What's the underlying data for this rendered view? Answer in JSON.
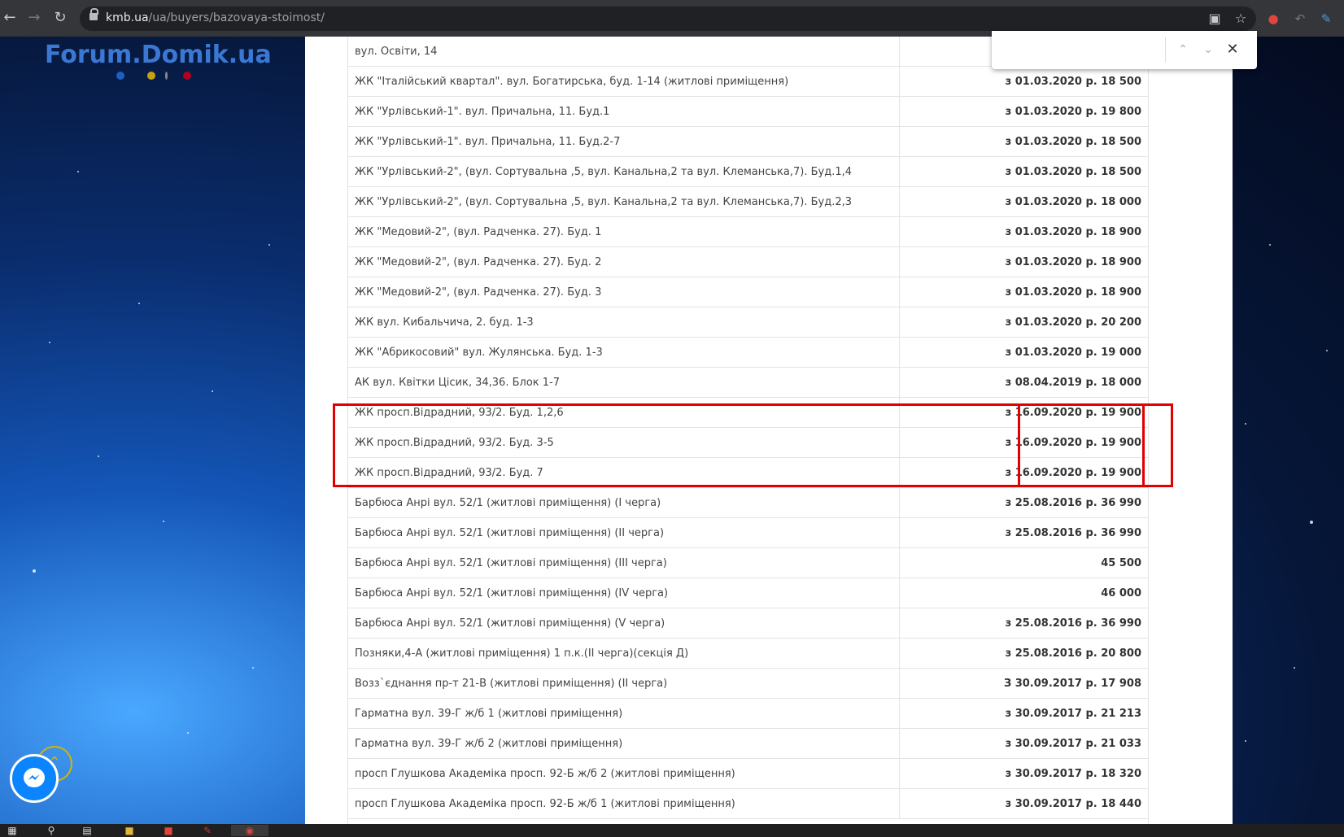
{
  "browser": {
    "url_host": "kmb.ua",
    "url_path": "/ua/buyers/bazovaya-stoimost/"
  },
  "site": {
    "logo_text": "Forum.Domik.ua",
    "logo_dot_colors": [
      "#1f5fbf",
      "#c8a010",
      "#8a8a8a",
      "#b00020"
    ]
  },
  "find_bar": {
    "value": ""
  },
  "table": {
    "rows": [
      {
        "address": "вул. Освіти, 14",
        "price": ""
      },
      {
        "address": " ЖК \"Італійський квартал\". вул. Богатирська, буд. 1-14 (житлові приміщення)",
        "price": "з 01.03.2020 р. 18 500"
      },
      {
        "address": "ЖК \"Урлівський-1\". вул. Причальна, 11. Буд.1",
        "price": "з 01.03.2020 р. 19 800"
      },
      {
        "address": "ЖК \"Урлівський-1\". вул. Причальна, 11. Буд.2-7",
        "price": "з 01.03.2020 р. 18 500"
      },
      {
        "address": " ЖК \"Урлівський-2\", (вул. Сортувальна ,5, вул. Канальна,2 та вул. Клеманська,7). Буд.1,4",
        "price": "з 01.03.2020 р. 18 500"
      },
      {
        "address": "ЖК \"Урлівський-2\", (вул. Сортувальна ,5, вул. Канальна,2 та вул. Клеманська,7). Буд.2,3",
        "price": "з 01.03.2020 р. 18 000"
      },
      {
        "address": "ЖК \"Медовий-2\", (вул. Радченка. 27). Буд. 1",
        "price": "з 01.03.2020 р. 18 900"
      },
      {
        "address": "ЖК \"Медовий-2\", (вул. Радченка. 27). Буд. 2",
        "price": "з 01.03.2020 р. 18 900"
      },
      {
        "address": "ЖК \"Медовий-2\", (вул. Радченка. 27). Буд. 3",
        "price": "з 01.03.2020 р. 18 900"
      },
      {
        "address": "ЖК вул. Кибальчича, 2. буд. 1-3",
        "price": "з 01.03.2020 р. 20 200"
      },
      {
        "address": "ЖК \"Абрикосовий\" вул. Жулянська. Буд. 1-3",
        "price": "з 01.03.2020 р. 19 000"
      },
      {
        "address": "АК вул. Квітки Цісик, 34,36. Блок 1-7",
        "price": "з 08.04.2019 р. 18 000"
      },
      {
        "address": "ЖК просп.Відрадний, 93/2. Буд. 1,2,6",
        "price": "з 16.09.2020 р. 19 900"
      },
      {
        "address": "ЖК просп.Відрадний, 93/2. Буд. 3-5",
        "price": "з 16.09.2020 р. 19 900"
      },
      {
        "address": "ЖК просп.Відрадний, 93/2. Буд. 7",
        "price": "з 16.09.2020 р. 19 900"
      },
      {
        "address": "Барбюса Анрі вул. 52/1 (житлові приміщення) (І черга)",
        "price": "з 25.08.2016 р. 36 990"
      },
      {
        "address": "Барбюса Анрі вул. 52/1 (житлові приміщення) (ІІ черга)",
        "price": "з 25.08.2016 р. 36 990"
      },
      {
        "address": "Барбюса Анрі вул. 52/1 (житлові приміщення) (ІІІ черга)",
        "price": "45 500"
      },
      {
        "address": "Барбюса Анрі вул. 52/1 (житлові приміщення) (IV черга)",
        "price": "46 000"
      },
      {
        "address": "Барбюса Анрі вул. 52/1 (житлові приміщення) (V черга)",
        "price": "з 25.08.2016 р. 36 990"
      },
      {
        "address": "Позняки,4-А (житлові приміщення) 1 п.к.(ІІ черга)(секція Д)",
        "price": "з 25.08.2016 р. 20 800"
      },
      {
        "address": "Возз`єднання пр-т 21-В (житлові приміщення) (ІІ черга)",
        "price": "З 30.09.2017 р. 17 908"
      },
      {
        "address": "Гарматна вул. 39-Г ж/б 1 (житлові приміщення)",
        "price": "з 30.09.2017 р. 21 213"
      },
      {
        "address": "Гарматна вул. 39-Г ж/б 2 (житлові приміщення)",
        "price": "з 30.09.2017 р. 21 033"
      },
      {
        "address": "просп Глушкова Академіка просп. 92-Б ж/б 2 (житлові приміщення)",
        "price": "з 30.09.2017 р. 18 320"
      },
      {
        "address": "просп Глушкова Академіка просп. 92-Б ж/б 1 (житлові приміщення)",
        "price": "з 30.09.2017 р. 18 440"
      }
    ]
  },
  "colors": {
    "highlight": "#e00000",
    "messenger": "#0a84ff",
    "scroll_top": "#d4b400"
  }
}
